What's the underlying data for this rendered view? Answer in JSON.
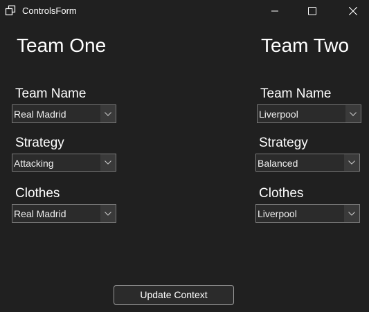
{
  "window": {
    "title": "ControlsForm",
    "icon": "window-stack-icon",
    "controls": [
      "minimize-icon",
      "maximize-icon",
      "close-icon"
    ]
  },
  "team_one": {
    "heading": "Team One",
    "team_name_label": "Team Name",
    "team_name_value": "Real Madrid",
    "strategy_label": "Strategy",
    "strategy_value": "Attacking",
    "clothes_label": "Clothes",
    "clothes_value": "Real Madrid"
  },
  "team_two": {
    "heading": "Team Two",
    "team_name_label": "Team Name",
    "team_name_value": "Liverpool",
    "strategy_label": "Strategy",
    "strategy_value": "Balanced",
    "clothes_label": "Clothes",
    "clothes_value": "Liverpool"
  },
  "actions": {
    "update_label": "Update Context"
  },
  "colors": {
    "background": "#202020",
    "text": "#ffffff",
    "control_border": "#7a7a7a"
  }
}
